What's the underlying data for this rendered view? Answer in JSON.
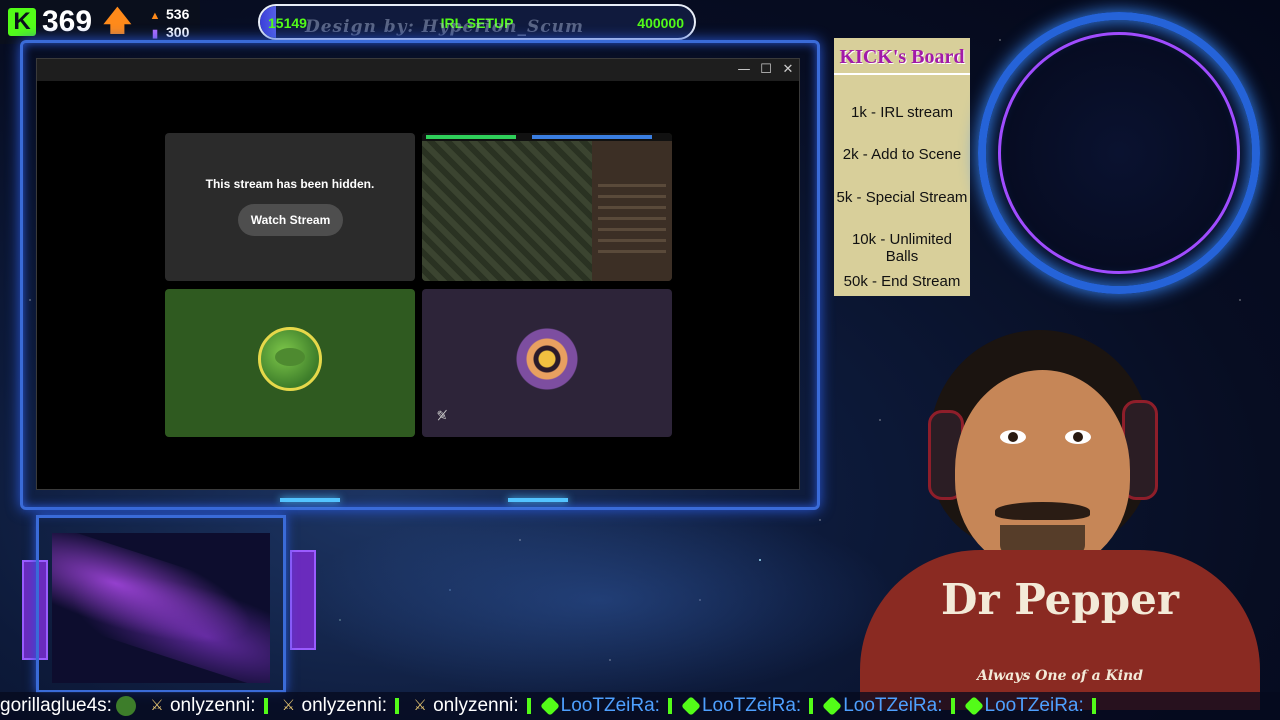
{
  "stats": {
    "followers": "369",
    "stat_top": "536",
    "stat_bottom": "300"
  },
  "goal": {
    "current": "15149",
    "label": "IRL SETUP",
    "target": "400000",
    "credit": "Design by: Hyperion_Scum",
    "progress_fraction": 0.038
  },
  "window": {
    "minimize": "—",
    "maximize": "☐",
    "close": "✕"
  },
  "tiles": {
    "hidden_message": "This stream has been hidden.",
    "watch_button": "Watch Stream"
  },
  "board": {
    "title": "KICK's Board",
    "items": [
      "1k - IRL stream",
      "2k - Add to Scene",
      "5k - Special Stream",
      "10k - Unlimited Balls",
      "50k - End Stream"
    ]
  },
  "shirt": {
    "title": "Dr Pepper",
    "subtitle": "Always One of a Kind"
  },
  "chat": [
    {
      "user": "gorillaglue4s:",
      "style": "plain"
    },
    {
      "user": "onlyzenni:",
      "style": "plain"
    },
    {
      "user": "onlyzenni:",
      "style": "plain"
    },
    {
      "user": "onlyzenni:",
      "style": "plain"
    },
    {
      "user": "LooTZeiRa:",
      "style": "green"
    },
    {
      "user": "LooTZeiRa:",
      "style": "green"
    },
    {
      "user": "LooTZeiRa:",
      "style": "green"
    },
    {
      "user": "LooTZeiRa:",
      "style": "green"
    }
  ],
  "colors": {
    "kick_green": "#53fc18",
    "frame_blue": "#3a6bd8",
    "board_bg": "#d8cf9a",
    "board_title": "#a21aa8"
  }
}
